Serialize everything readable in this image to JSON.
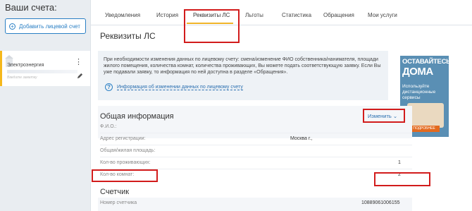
{
  "sidebar": {
    "title": "Ваши счета:",
    "add_button": "Добавить лицевой счет",
    "account": {
      "name": "Электроэнергия",
      "note": "Введите заметку"
    }
  },
  "tabs": [
    {
      "label": "Уведомления"
    },
    {
      "label": "История"
    },
    {
      "label": "Реквизиты ЛС",
      "active": true
    },
    {
      "label": "Льготы"
    },
    {
      "label": "Статистика"
    },
    {
      "label": "Обращения"
    },
    {
      "label": "Мои услуги"
    }
  ],
  "page": {
    "title": "Реквизиты ЛС",
    "notice": "При необходимости изменения данных по лицевому счету: смена/изменение ФИО собственника/нанимателя, площади жилого помещения, количества комнат, количества проживающих, Вы можете подать соответствующую заявку. Если Вы уже подавали заявку, то информация по ней доступна в разделе «Обращения».",
    "help_link": "Информация об изменении данных по лицевому счету"
  },
  "ad": {
    "line1": "ОСТАВАЙТЕСЬ",
    "line2": "ДОМА",
    "subtitle": "Используйте дистанционные сервисы",
    "cta": "ПОДРОБНЕЕ"
  },
  "general": {
    "title": "Общая информация",
    "edit_label": "Изменить",
    "rows": [
      {
        "label": "Ф.И.О.:",
        "value": ""
      },
      {
        "label": "Адрес регистрации:",
        "value": "Москва г.,"
      },
      {
        "label": "Общая/жилая площадь:",
        "value": ""
      },
      {
        "label": "Кол-во проживающих:",
        "value": "1"
      },
      {
        "label": "Кол-во комнат:",
        "value": "2"
      }
    ]
  },
  "meter": {
    "title": "Счетчик",
    "label": "Номер счетчика",
    "value": "10889061006155"
  },
  "colors": {
    "accent": "#2a7fc4",
    "highlight": "#f0b429",
    "annotation": "#d21c1c"
  }
}
